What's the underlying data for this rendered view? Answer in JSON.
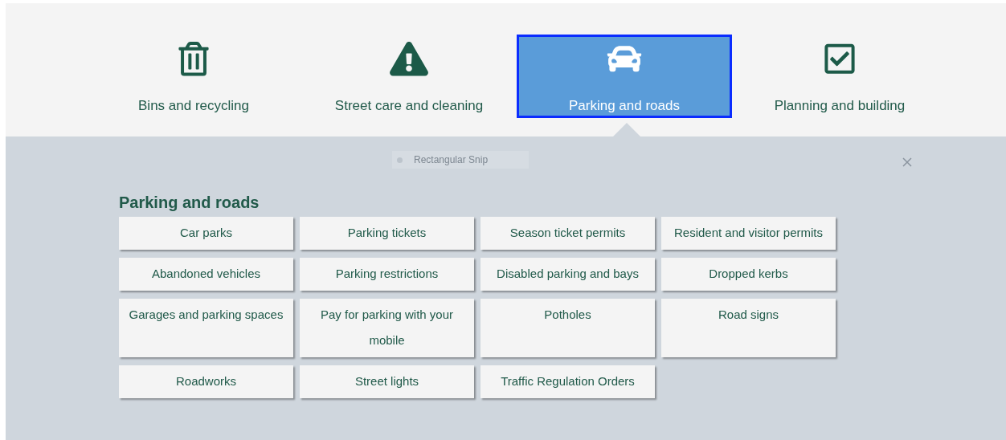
{
  "tabs": [
    {
      "label": "Bins and recycling",
      "selected": false
    },
    {
      "label": "Street care and cleaning",
      "selected": false
    },
    {
      "label": "Parking and roads",
      "selected": true
    },
    {
      "label": "Planning and building",
      "selected": false
    }
  ],
  "snip_label": "Rectangular Snip",
  "panel": {
    "title": "Parking and roads",
    "links": [
      "Car parks",
      "Parking tickets",
      "Season ticket permits",
      "Resident and visitor permits",
      "Abandoned vehicles",
      "Parking restrictions",
      "Disabled parking and bays",
      "Dropped kerbs",
      "Garages and parking spaces",
      "Pay for parking with your mobile",
      "Potholes",
      "Road signs",
      "Roadworks",
      "Street lights",
      "Traffic Regulation Orders"
    ]
  }
}
